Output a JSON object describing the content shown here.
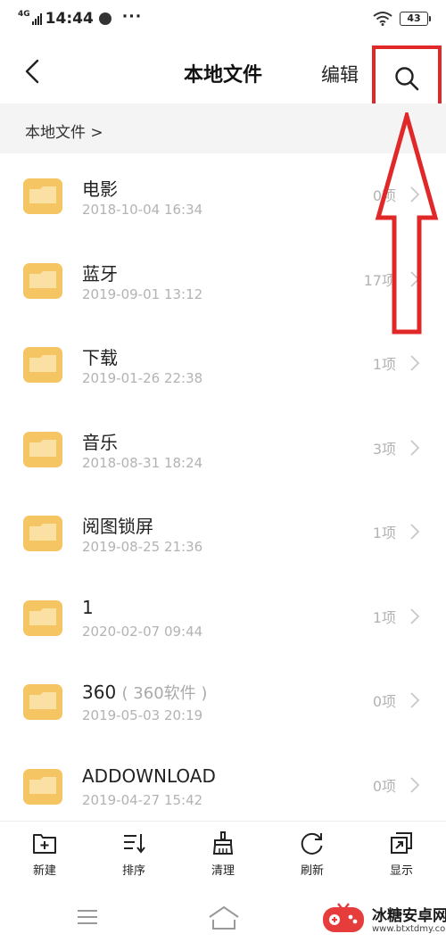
{
  "status_bar": {
    "network": "4G",
    "time": "14:44",
    "more": "···",
    "battery": "43"
  },
  "header": {
    "title": "本地文件",
    "edit_label": "编辑",
    "back_icon": "back-arrow-icon",
    "search_icon": "search-icon"
  },
  "breadcrumb": "本地文件 >",
  "files": [
    {
      "name": "电影",
      "alias": "",
      "date": "2018-10-04 16:34",
      "count": "0项"
    },
    {
      "name": "蓝牙",
      "alias": "",
      "date": "2019-09-01 13:12",
      "count": "17项"
    },
    {
      "name": "下载",
      "alias": "",
      "date": "2019-01-26 22:38",
      "count": "1项"
    },
    {
      "name": "音乐",
      "alias": "",
      "date": "2018-08-31 18:24",
      "count": "3项"
    },
    {
      "name": "阅图锁屏",
      "alias": "",
      "date": "2019-08-25 21:36",
      "count": "1项"
    },
    {
      "name": "1",
      "alias": "",
      "date": "2020-02-07 09:44",
      "count": "1项"
    },
    {
      "name": "360",
      "alias": "( 360软件 )",
      "date": "2019-05-03 20:19",
      "count": "0项"
    },
    {
      "name": "ADDOWNLOAD",
      "alias": "",
      "date": "2019-04-27 15:42",
      "count": "0项"
    }
  ],
  "toolbar": {
    "new_label": "新建",
    "sort_label": "排序",
    "clean_label": "清理",
    "refresh_label": "刷新",
    "display_label": "显示"
  },
  "watermark": {
    "text": "冰糖安卓网",
    "url": "www.btxtdmy.com"
  },
  "colors": {
    "folder": "#f5c463",
    "folder_tab": "#f0b640",
    "annotation": "#e02828",
    "breadcrumb_bg": "#f4f4f4"
  }
}
